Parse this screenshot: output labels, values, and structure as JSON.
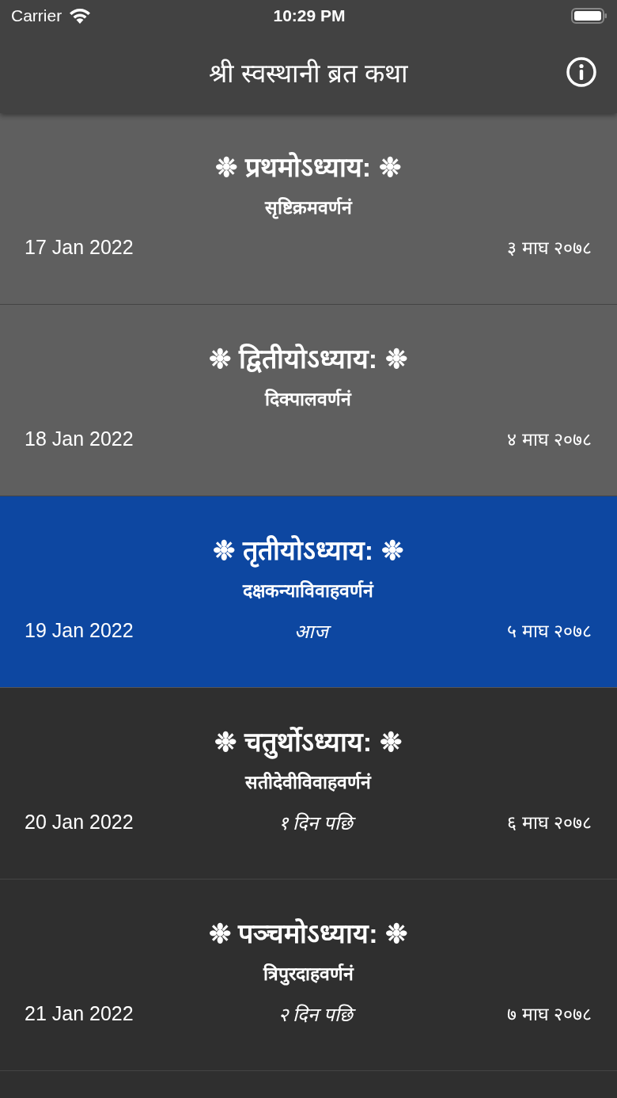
{
  "status_bar": {
    "carrier": "Carrier",
    "time": "10:29 PM"
  },
  "nav_bar": {
    "title": "श्री स्वस्थानी ब्रत कथा"
  },
  "chapters": [
    {
      "kind": "past",
      "title": "❉ प्रथमोऽध्याय: ❉",
      "subtitle": "सृष्टिक्रमवर्णनं",
      "date": "17 Jan 2022",
      "nepali_date": "३ माघ २०७८"
    },
    {
      "kind": "past",
      "title": "❉ द्वितीयोऽध्याय: ❉",
      "subtitle": "दिक्पालवर्णनं",
      "date": "18 Jan 2022",
      "nepali_date": "४ माघ २०७८"
    },
    {
      "kind": "today",
      "title": "❉ तृतीयोऽध्याय: ❉",
      "subtitle": "दक्षकन्याविवाहवर्णनं",
      "date": "19 Jan 2022",
      "relative": "आज",
      "nepali_date": "५ माघ २०७८"
    },
    {
      "kind": "future",
      "title": "❉ चतुर्थोऽध्याय: ❉",
      "subtitle": "सतीदेवीविवाहवर्णनं",
      "date": "20 Jan 2022",
      "relative": "१ दिन पछि",
      "nepali_date": "६ माघ २०७८"
    },
    {
      "kind": "future",
      "title": "❉ पञ्चमोऽध्याय: ❉",
      "subtitle": "त्रिपुरदाहवर्णनं",
      "date": "21 Jan 2022",
      "relative": "२ दिन पछि",
      "nepali_date": "७ माघ २०७८"
    }
  ]
}
